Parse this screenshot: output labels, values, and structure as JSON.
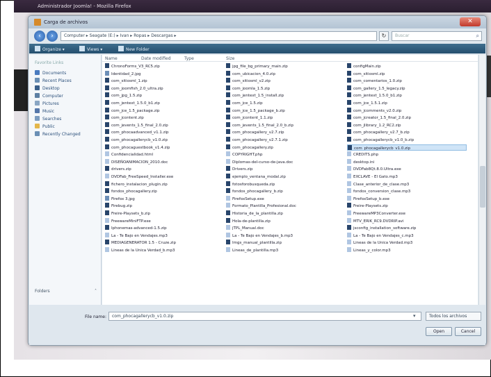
{
  "window": {
    "browser_title": "Administrador Joomla! - Mozilla Firefox",
    "dialog_title": "Carga de archivos"
  },
  "address": {
    "path": "Computer ▸ Seagate (E:) ▸ Ivan ▸ Ropas ▸ Descargas ▸",
    "search_placeholder": "Buscar"
  },
  "toolbar": {
    "organize": "Organize ▾",
    "views": "Views ▾",
    "new_folder": "New Folder"
  },
  "nav": {
    "heading": "Favorite Links",
    "items": [
      {
        "label": "Documents",
        "color": "#4a7bbf"
      },
      {
        "label": "Recent Places",
        "color": "#6a8fb5"
      },
      {
        "label": "Desktop",
        "color": "#3a5f8a"
      },
      {
        "label": "Computer",
        "color": "#5d7fa3"
      },
      {
        "label": "Pictures",
        "color": "#8aa6c4"
      },
      {
        "label": "Music",
        "color": "#5577aa"
      },
      {
        "label": "Searches",
        "color": "#7b9cc0"
      },
      {
        "label": "Public",
        "color": "#e4b64a"
      },
      {
        "label": "Recently Changed",
        "color": "#6a8fb5"
      }
    ],
    "folders_label": "Folders"
  },
  "columns": {
    "name": "Name",
    "date": "Date modified",
    "type": "Type",
    "size": "Size"
  },
  "files": [
    {
      "name": "ChronoForms_V3_RC5.zip",
      "icon": "zip"
    },
    {
      "name": "jpg_file_bg_primary_main.zip",
      "icon": "zip"
    },
    {
      "name": "configMain.zip",
      "icon": "zip"
    },
    {
      "name": "Identidad_2.jpg",
      "icon": "img"
    },
    {
      "name": "com_ubicacion_4.0.zip",
      "icon": "zip"
    },
    {
      "name": "com_sitiosml.zip",
      "icon": "zip"
    },
    {
      "name": "com_sitiosml_1.zip",
      "icon": "zip"
    },
    {
      "name": "com_sitiosml_v2.zip",
      "icon": "zip"
    },
    {
      "name": "com_comentarios_1.0.zip",
      "icon": "zip"
    },
    {
      "name": "com_joomfish_2.0_ultra.zip",
      "icon": "zip"
    },
    {
      "name": "com_joomla_1.5.zip",
      "icon": "zip"
    },
    {
      "name": "com_gallery_1.5_legacy.zip",
      "icon": "zip"
    },
    {
      "name": "com_jpg_1.5.zip",
      "icon": "zip"
    },
    {
      "name": "com_jentext_1.5_install.zip",
      "icon": "zip"
    },
    {
      "name": "com_jentext_1.5.0_b1.zip",
      "icon": "zip"
    },
    {
      "name": "com_jentext_1.5.0_b1.zip",
      "icon": "zip"
    },
    {
      "name": "com_jce_1.5.zip",
      "icon": "zip"
    },
    {
      "name": "com_jce_1.5.1.zip",
      "icon": "zip"
    },
    {
      "name": "com_jce_1.5_package.zip",
      "icon": "zip"
    },
    {
      "name": "com_jce_1.5_package_b.zip",
      "icon": "zip"
    },
    {
      "name": "com_jcomments_v2.0.zip",
      "icon": "zip"
    },
    {
      "name": "com_jcontent.zip",
      "icon": "zip"
    },
    {
      "name": "com_jcontent_1.1.zip",
      "icon": "zip"
    },
    {
      "name": "com_jcreator_1.5_final_2.0.zip",
      "icon": "zip"
    },
    {
      "name": "com_jevents_1.5_final_2.0.zip",
      "icon": "zip"
    },
    {
      "name": "com_jevents_1.5_final_2.0_b.zip",
      "icon": "zip"
    },
    {
      "name": "com_jlibrary_1.2_RC2.zip",
      "icon": "zip"
    },
    {
      "name": "com_phocaadvanced_v1.1.zip",
      "icon": "zip"
    },
    {
      "name": "com_phocagallery_v2.7.zip",
      "icon": "zip"
    },
    {
      "name": "com_phocagallery_v2.7_b.zip",
      "icon": "zip"
    },
    {
      "name": "com_phocagallerycb_v1.0.zip",
      "icon": "zip"
    },
    {
      "name": "com_phocagallery_v2.7.1.zip",
      "icon": "zip"
    },
    {
      "name": "com_phocagallerycb_v1.0_b.zip",
      "icon": "zip"
    },
    {
      "name": "com_phocaguestbook_v1.4.zip",
      "icon": "zip"
    },
    {
      "name": "com_phocagallery.zip",
      "icon": "zip"
    },
    {
      "name": "com_phocagallerycb_v1.0.zip",
      "icon": "zip",
      "selected": true
    },
    {
      "name": "Confidencialidad.html",
      "icon": "doc"
    },
    {
      "name": "COPYRIGHT.php",
      "icon": "doc"
    },
    {
      "name": "CREDITS.php",
      "icon": "doc"
    },
    {
      "name": "DISEÑOANIMACION_2010.doc",
      "icon": "doc"
    },
    {
      "name": "Diplomas-del-curso-de-java.doc",
      "icon": "doc"
    },
    {
      "name": "desktop.ini",
      "icon": "doc"
    },
    {
      "name": "drivers.zip",
      "icon": "zip"
    },
    {
      "name": "Drivers.zip",
      "icon": "zip"
    },
    {
      "name": "DVDFab8Qt.8.0.Ultra.exe",
      "icon": "doc"
    },
    {
      "name": "DVDFab_FreeSpeed_Installer.exe",
      "icon": "doc"
    },
    {
      "name": "ejemplo_ventana_modal.zip",
      "icon": "zip"
    },
    {
      "name": "EXCLAVE - El Gato.mp3",
      "icon": "doc"
    },
    {
      "name": "fichero_instalacion_plugin.zip",
      "icon": "zip"
    },
    {
      "name": "fotosforobusqueda.zip",
      "icon": "zip"
    },
    {
      "name": "Clase_anterior_de_clase.mp3",
      "icon": "doc"
    },
    {
      "name": "fondos_phocagallery.zip",
      "icon": "zip"
    },
    {
      "name": "fondos_phocagallery_b.zip",
      "icon": "zip"
    },
    {
      "name": "fondos_conversion_clase.mp3",
      "icon": "doc"
    },
    {
      "name": "Firefox 3.jpg",
      "icon": "img"
    },
    {
      "name": "FirefoxSetup.exe",
      "icon": "doc"
    },
    {
      "name": "FirefoxSetup_b.exe",
      "icon": "doc"
    },
    {
      "name": "Firebug.zip",
      "icon": "zip"
    },
    {
      "name": "Formato_Plantilla_Profesional.doc",
      "icon": "doc"
    },
    {
      "name": "Freire-Playsets.zip",
      "icon": "zip"
    },
    {
      "name": "Freire-Playsets_b.zip",
      "icon": "zip"
    },
    {
      "name": "Historia_de_la_plantilla.zip",
      "icon": "zip"
    },
    {
      "name": "FreewareMP3Converter.exe",
      "icon": "doc"
    },
    {
      "name": "FreewareMiniFTP.exe",
      "icon": "doc"
    },
    {
      "name": "Hola-de-plantilla.zip",
      "icon": "zip"
    },
    {
      "name": "MTV_ERIK_RC9.DVDRIP.avi",
      "icon": "doc"
    },
    {
      "name": "Iphonemas-advanced-1.5.zip",
      "icon": "zip"
    },
    {
      "name": "jTPL_Manual.doc",
      "icon": "doc"
    },
    {
      "name": "jsconfig_installation_software.zip",
      "icon": "zip"
    },
    {
      "name": "La - Te Bajo en Vendajes.mp3",
      "icon": "doc"
    },
    {
      "name": "La - Te Bajo en Vendajes_b.mp3",
      "icon": "doc"
    },
    {
      "name": "La - Te Bajo en Vendajes_c.mp3",
      "icon": "doc"
    },
    {
      "name": "MEDIAGENERATOR 1.5 - Cruze.zip",
      "icon": "zip"
    },
    {
      "name": "Imgs_manual_plantilla.zip",
      "icon": "zip"
    },
    {
      "name": "Lineas de la Unica Verdad.mp3",
      "icon": "doc"
    },
    {
      "name": "Lineas de la Unica Verdad_b.mp3",
      "icon": "doc"
    },
    {
      "name": "Lineas_de_plantilla.mp3",
      "icon": "doc"
    },
    {
      "name": "Lineas_y_color.mp3",
      "icon": "doc"
    }
  ],
  "bottom": {
    "filename_label": "File name:",
    "filename_value": "com_phocagallerycb_v1.0.zip",
    "filetype": "Todos los archivos",
    "open": "Open",
    "cancel": "Cancel"
  },
  "colors": {
    "toolbar": "#2f5c7d",
    "selection": "#cfe4f7",
    "close": "#c0392b"
  }
}
